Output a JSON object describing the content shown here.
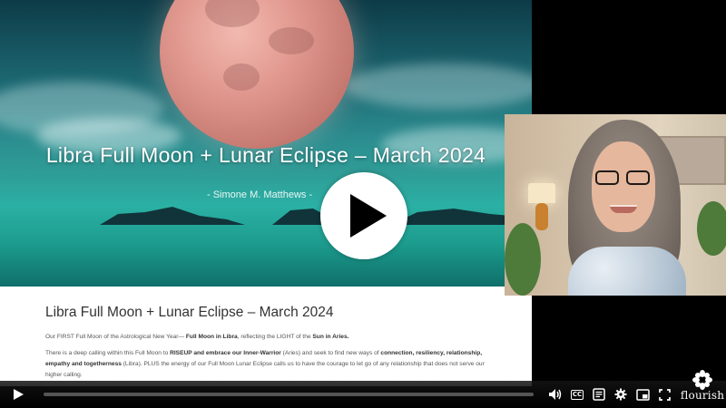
{
  "video": {
    "slide_title": "Libra Full Moon + Lunar Eclipse – March 2024",
    "slide_author": "- Simone M. Matthews -",
    "progress": 0.0
  },
  "article": {
    "title": "Libra Full Moon + Lunar Eclipse – March 2024",
    "p1_a": "Our FIRST Full Moon of the Astrological New Year— ",
    "p1_b": "Full Moon in Libra",
    "p1_c": ", reflecting the LIGHT of the ",
    "p1_d": "Sun in Aries.",
    "p2_a": "There is a deep calling within this Full Moon to ",
    "p2_b": "RISEUP and embrace our Inner-Warrior",
    "p2_c": " (Aries) and seek to find new ways of ",
    "p2_d": "connection, resiliency, relationship, empathy and togetherness",
    "p2_e": " (Libra).  PLUS the energy of our Full Moon Lunar Eclipse calls us to have the courage to let go of any relationship that does not serve our higher calling."
  },
  "controls": {
    "cc_label": "CC",
    "icons": [
      "play-icon",
      "volume-icon",
      "captions-icon",
      "transcript-icon",
      "settings-icon",
      "picture-in-picture-icon",
      "fullscreen-icon"
    ]
  },
  "brand": {
    "logo_text": "flourish"
  }
}
